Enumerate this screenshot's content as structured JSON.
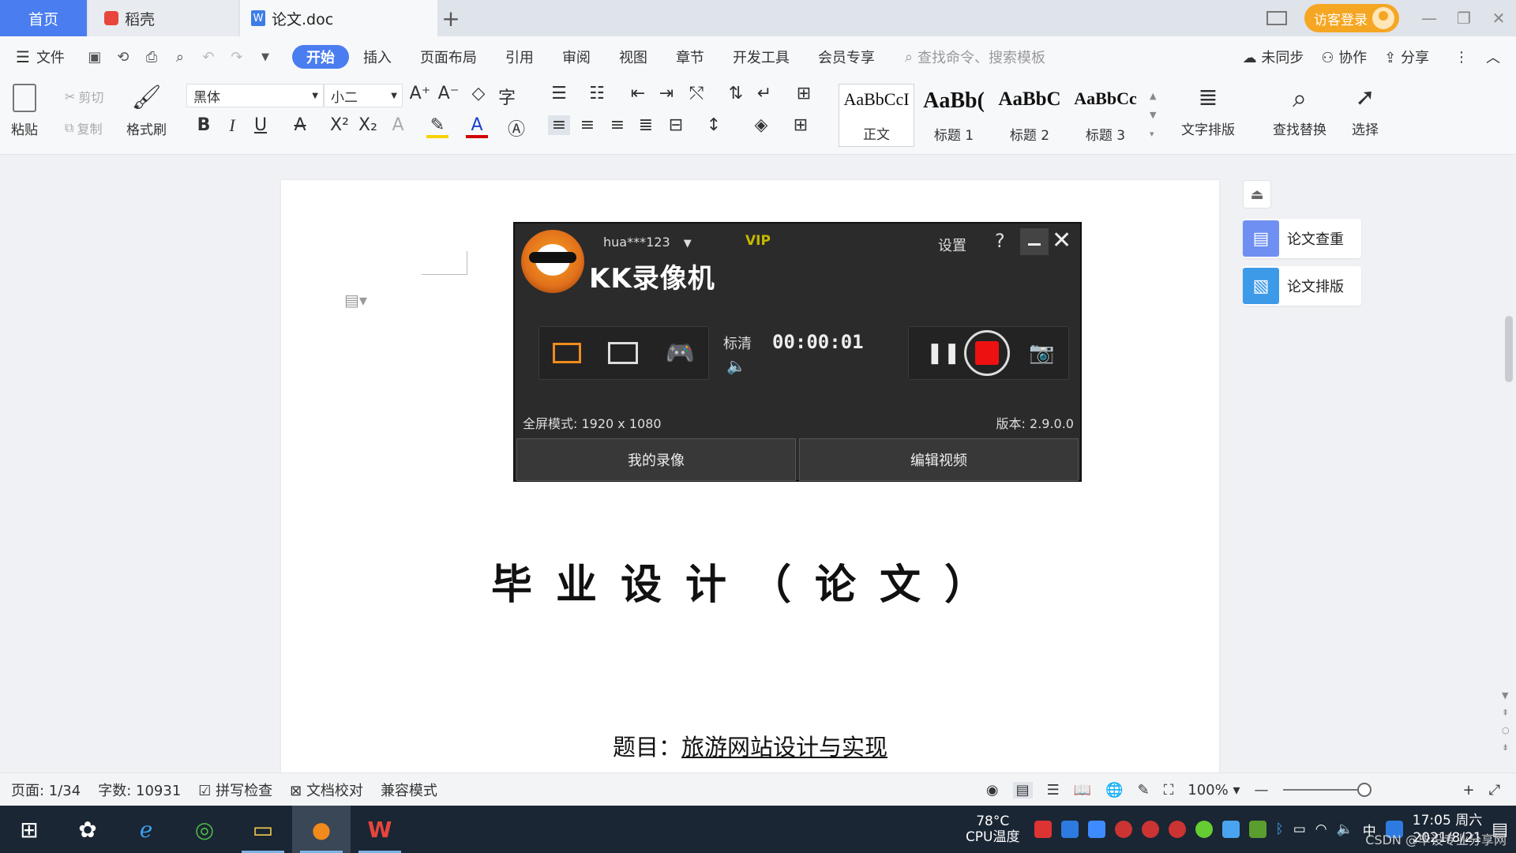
{
  "tabs": {
    "home": "首页",
    "daoke": "稻壳",
    "doc": "论文.doc"
  },
  "login": {
    "label": "访客登录"
  },
  "menu": {
    "file": "文件",
    "items": [
      "开始",
      "插入",
      "页面布局",
      "引用",
      "审阅",
      "视图",
      "章节",
      "开发工具",
      "会员专享"
    ],
    "search_placeholder": "查找命令、搜索模板",
    "right": [
      "未同步",
      "协作",
      "分享"
    ]
  },
  "ribbon": {
    "paste": "粘贴",
    "cut": "剪切",
    "copy": "复制",
    "format_painter": "格式刷",
    "font": "黑体",
    "size": "小二",
    "styles": [
      {
        "preview": "AaBbCcI",
        "label": "正文"
      },
      {
        "preview": "AaBb(",
        "label": "标题 1"
      },
      {
        "preview": "AaBbC",
        "label": "标题 2"
      },
      {
        "preview": "AaBbCc",
        "label": "标题 3"
      }
    ],
    "text_layout": "文字排版",
    "find_replace": "查找替换",
    "select": "选择"
  },
  "document": {
    "title": "毕业设计（论文）",
    "topic_label": "题目：",
    "topic_value": "旅游网站设计与实现"
  },
  "kk": {
    "user": "hua***123",
    "vip": "VIP",
    "brand": "KK录像机",
    "settings": "设置",
    "help": "?",
    "quality": "标清",
    "time": "00:00:01",
    "fullscreen_mode": "全屏模式: 1920 x 1080",
    "version": "版本: 2.9.0.0",
    "my_videos": "我的录像",
    "edit_video": "编辑视频"
  },
  "side_panel": {
    "check": "论文查重",
    "layout": "论文排版"
  },
  "status": {
    "page": "页面: 1/34",
    "words": "字数: 10931",
    "spell": "拼写检查",
    "proofread": "文档校对",
    "compat": "兼容模式",
    "zoom": "100%"
  },
  "taskbar": {
    "cpu_temp": "78°C",
    "cpu_label": "CPU温度",
    "ime": "中",
    "time": "17:05 周六",
    "date": "2021/8/21",
    "watermark": "CSDN @毕设专业分享网"
  },
  "colors": {
    "accent": "#4a7df0",
    "login": "#f5a623",
    "record": "#ee1111"
  }
}
